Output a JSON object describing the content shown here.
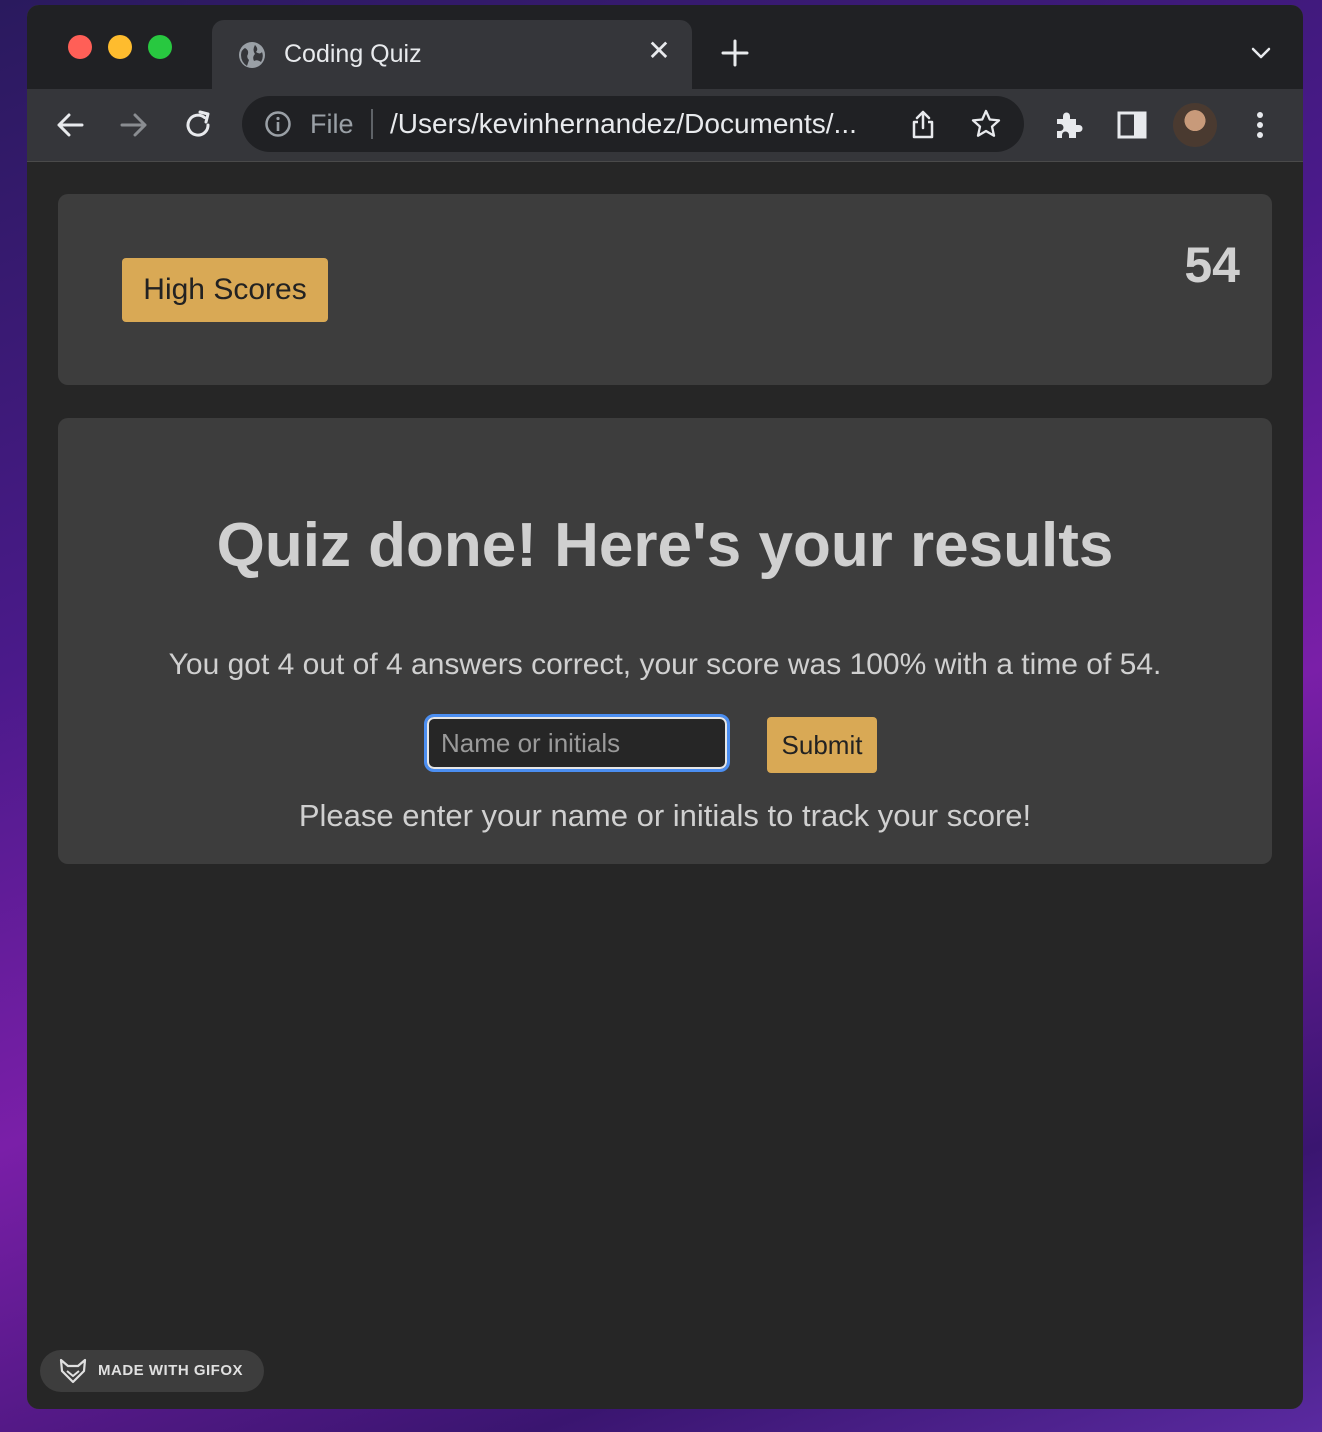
{
  "browser": {
    "tab": {
      "title": "Coding Quiz",
      "favicon": "globe-icon",
      "close": "✕"
    },
    "address_bar": {
      "scheme_label": "File",
      "url": "/Users/kevinhernandez/Documents/..."
    },
    "icons": [
      "back-arrow-icon",
      "forward-arrow-icon",
      "reload-icon",
      "info-icon",
      "share-icon",
      "star-icon",
      "extensions-icon",
      "side-panel-icon",
      "kebab-menu-icon",
      "chevron-down-icon",
      "plus-icon"
    ]
  },
  "header": {
    "high_scores_label": "High Scores",
    "timer": "54"
  },
  "results": {
    "title": "Quiz done! Here's your results",
    "summary": "You got 4 out of 4 answers correct, your score was 100% with a time of 54.",
    "input_placeholder": "Name or initials",
    "submit_label": "Submit",
    "prompt": "Please enter your name or initials to track your score!"
  },
  "watermark": {
    "label": "MADE WITH GIFOX"
  },
  "colors": {
    "accent": "#d9a955",
    "page_bg": "#262626",
    "card_bg": "#3d3d3d",
    "text": "#d0d0d0",
    "focus_ring": "#4b8ef1"
  }
}
